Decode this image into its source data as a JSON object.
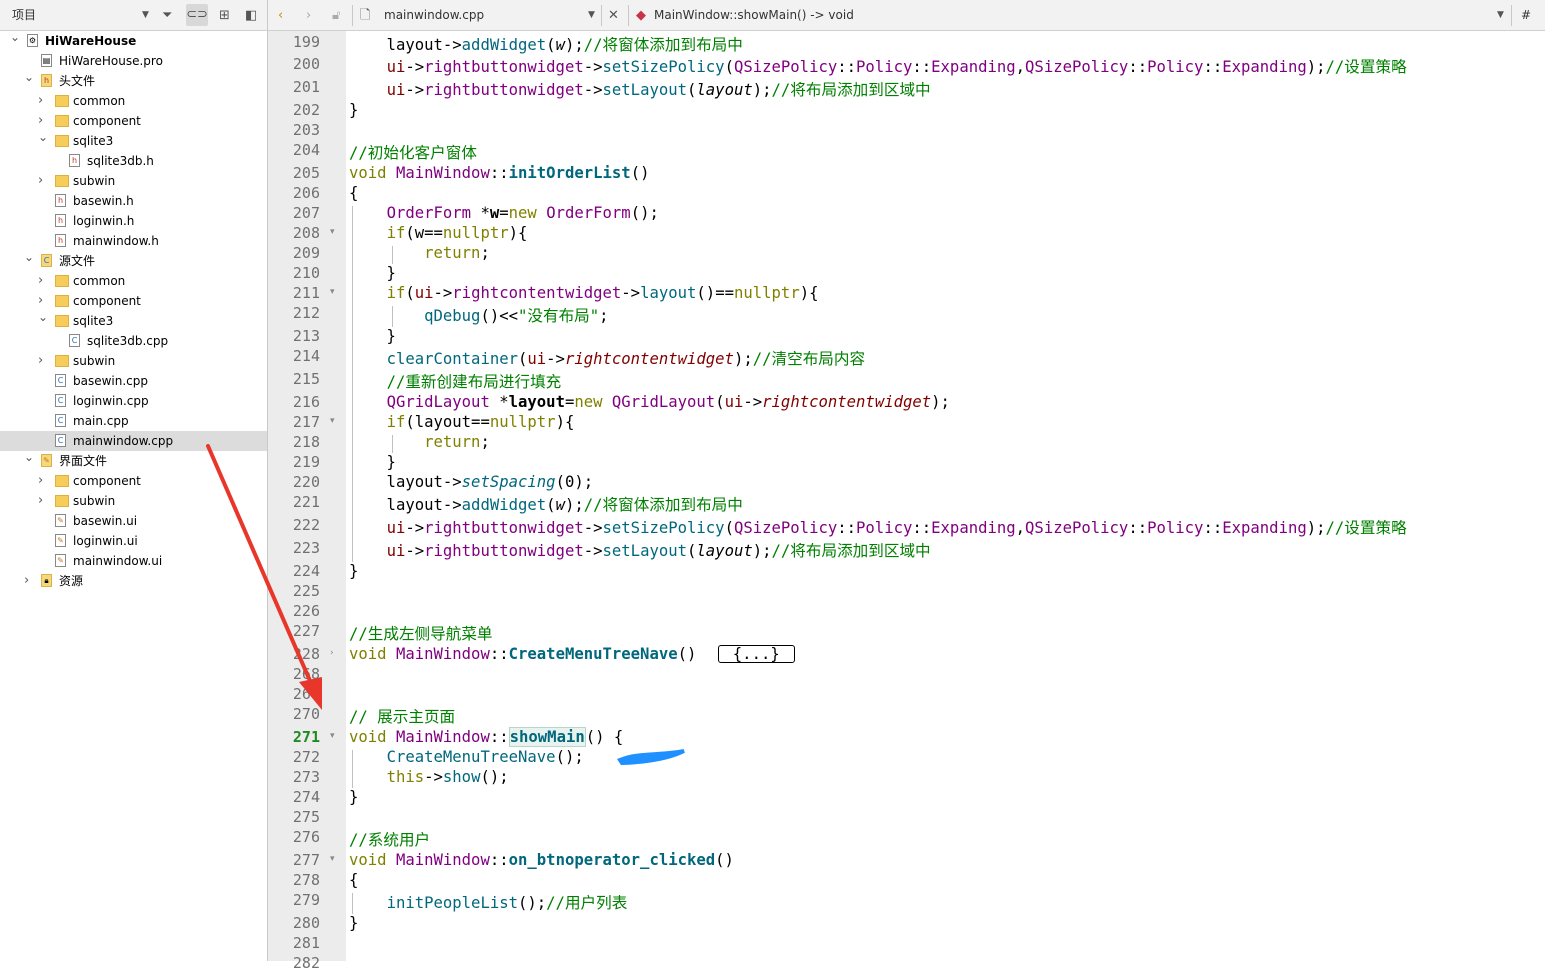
{
  "project_panel": {
    "title": "项目",
    "tree": [
      {
        "label": "HiWareHouse",
        "level": 0,
        "type": "project",
        "expanded": true,
        "bold": true
      },
      {
        "label": "HiWareHouse.pro",
        "level": 1,
        "type": "pro"
      },
      {
        "label": "头文件",
        "level": 1,
        "type": "group-h",
        "expanded": true
      },
      {
        "label": "common",
        "level": 2,
        "type": "folder",
        "expanded": false
      },
      {
        "label": "component",
        "level": 2,
        "type": "folder",
        "expanded": false
      },
      {
        "label": "sqlite3",
        "level": 2,
        "type": "folder",
        "expanded": true
      },
      {
        "label": "sqlite3db.h",
        "level": 3,
        "type": "h"
      },
      {
        "label": "subwin",
        "level": 2,
        "type": "folder",
        "expanded": false
      },
      {
        "label": "basewin.h",
        "level": 2,
        "type": "h"
      },
      {
        "label": "loginwin.h",
        "level": 2,
        "type": "h"
      },
      {
        "label": "mainwindow.h",
        "level": 2,
        "type": "h"
      },
      {
        "label": "源文件",
        "level": 1,
        "type": "group-cpp",
        "expanded": true
      },
      {
        "label": "common",
        "level": 2,
        "type": "folder",
        "expanded": false
      },
      {
        "label": "component",
        "level": 2,
        "type": "folder",
        "expanded": false
      },
      {
        "label": "sqlite3",
        "level": 2,
        "type": "folder",
        "expanded": true
      },
      {
        "label": "sqlite3db.cpp",
        "level": 3,
        "type": "cpp"
      },
      {
        "label": "subwin",
        "level": 2,
        "type": "folder",
        "expanded": false
      },
      {
        "label": "basewin.cpp",
        "level": 2,
        "type": "cpp"
      },
      {
        "label": "loginwin.cpp",
        "level": 2,
        "type": "cpp"
      },
      {
        "label": "main.cpp",
        "level": 2,
        "type": "cpp"
      },
      {
        "label": "mainwindow.cpp",
        "level": 2,
        "type": "cpp",
        "selected": true
      },
      {
        "label": "界面文件",
        "level": 1,
        "type": "group-ui",
        "expanded": true
      },
      {
        "label": "component",
        "level": 2,
        "type": "folder",
        "expanded": false
      },
      {
        "label": "subwin",
        "level": 2,
        "type": "folder",
        "expanded": false
      },
      {
        "label": "basewin.ui",
        "level": 2,
        "type": "ui"
      },
      {
        "label": "loginwin.ui",
        "level": 2,
        "type": "ui"
      },
      {
        "label": "mainwindow.ui",
        "level": 2,
        "type": "ui"
      },
      {
        "label": "资源",
        "level": 1,
        "type": "group-res",
        "expanded": false
      }
    ]
  },
  "editor_toolbar": {
    "file": "mainwindow.cpp",
    "function": "MainWindow::showMain() -> void",
    "hash": "#"
  },
  "editor": {
    "current_line": 271,
    "lines": [
      {
        "n": "199",
        "html": "    layout-><span class='f'>addWidget</span>(<span class='it'>w</span>);<span class='c'>//将窗体添加到布局中</span>"
      },
      {
        "n": "200",
        "html": "    <span class='m' style='font-style:normal'>ui</span>-><span class='t'>rightbuttonwidget</span>-><span class='f'>setSizePolicy</span>(<span class='t'>QSizePolicy</span>::<span class='t'>Policy</span>::<span class='t'>Expanding</span>,<span class='t'>QSizePolicy</span>::<span class='t'>Policy</span>::<span class='t'>Expanding</span>);<span class='c'>//设置策略</span>"
      },
      {
        "n": "201",
        "html": "    <span class='m' style='font-style:normal'>ui</span>-><span class='t'>rightbuttonwidget</span>-><span class='f'>setLayout</span>(<span class='it'>layout</span>);<span class='c'>//将布局添加到区域中</span>"
      },
      {
        "n": "202",
        "html": "}"
      },
      {
        "n": "203",
        "html": ""
      },
      {
        "n": "204",
        "html": "<span class='c'>//初始化客户窗体</span>"
      },
      {
        "n": "205",
        "html": "<span class='k'>void</span> <span class='t'>MainWindow</span>::<span class='fb'>initOrderList</span>()"
      },
      {
        "n": "206",
        "html": "{"
      },
      {
        "n": "207",
        "html": "    <span class='t'>OrderForm</span> *<b>w</b>=<span class='k'>new</span> <span class='t'>OrderForm</span>();"
      },
      {
        "n": "208",
        "html": "    <span class='k'>if</span>(w==<span class='k'>nullptr</span>){"
      },
      {
        "n": "209",
        "html": "        <span class='k'>return</span>;"
      },
      {
        "n": "210",
        "html": "    }"
      },
      {
        "n": "211",
        "html": "    <span class='k'>if</span>(<span class='m' style='font-style:normal'>ui</span>-><span class='t'>rightcontentwidget</span>-><span class='f'>layout</span>()==<span class='k'>nullptr</span>){"
      },
      {
        "n": "212",
        "html": "        <span class='f'>qDebug</span>()<<<span class='s'>\"没有布局\"</span>;"
      },
      {
        "n": "213",
        "html": "    }"
      },
      {
        "n": "214",
        "html": "    <span class='f'>clearContainer</span>(<span class='m' style='font-style:normal'>ui</span>-><span class='m'>rightcontentwidget</span>);<span class='c'>//清空布局内容</span>"
      },
      {
        "n": "215",
        "html": "    <span class='c'>//重新创建布局进行填充</span>"
      },
      {
        "n": "216",
        "html": "    <span class='t'>QGridLayout</span> *<b>layout</b>=<span class='k'>new</span> <span class='t'>QGridLayout</span>(<span class='m' style='font-style:normal'>ui</span>-><span class='m'>rightcontentwidget</span>);"
      },
      {
        "n": "217",
        "html": "    <span class='k'>if</span>(layout==<span class='k'>nullptr</span>){"
      },
      {
        "n": "218",
        "html": "        <span class='k'>return</span>;"
      },
      {
        "n": "219",
        "html": "    }"
      },
      {
        "n": "220",
        "html": "    layout-><span class='f it'>setSpacing</span>(0);"
      },
      {
        "n": "221",
        "html": "    layout-><span class='f'>addWidget</span>(<span class='it'>w</span>);<span class='c'>//将窗体添加到布局中</span>"
      },
      {
        "n": "222",
        "html": "    <span class='m' style='font-style:normal'>ui</span>-><span class='t'>rightbuttonwidget</span>-><span class='f'>setSizePolicy</span>(<span class='t'>QSizePolicy</span>::<span class='t'>Policy</span>::<span class='t'>Expanding</span>,<span class='t'>QSizePolicy</span>::<span class='t'>Policy</span>::<span class='t'>Expanding</span>);<span class='c'>//设置策略</span>"
      },
      {
        "n": "223",
        "html": "    <span class='m' style='font-style:normal'>ui</span>-><span class='t'>rightbuttonwidget</span>-><span class='f'>setLayout</span>(<span class='it'>layout</span>);<span class='c'>//将布局添加到区域中</span>"
      },
      {
        "n": "224",
        "html": "}"
      },
      {
        "n": "225",
        "html": ""
      },
      {
        "n": "226",
        "html": ""
      },
      {
        "n": "227",
        "html": "<span class='c'>//生成左侧导航菜单</span>"
      },
      {
        "n": "228",
        "html": "<span class='k'>void</span> <span class='t'>MainWindow</span>::<span class='fb'>CreateMenuTreeNave</span>() <span class='collapsed'>{...}</span>"
      },
      {
        "n": "268",
        "html": ""
      },
      {
        "n": "269",
        "html": ""
      },
      {
        "n": "270",
        "html": "<span class='c'>// 展示主页面</span>"
      },
      {
        "n": "271",
        "html": "<span class='k'>void</span> <span class='t'>MainWindow</span>::<span class='fb hl-word'>showMain</span>() {"
      },
      {
        "n": "272",
        "html": "    <span class='f'>CreateMenuTreeNave</span>();"
      },
      {
        "n": "273",
        "html": "    <span class='k'>this</span>-><span class='f'>show</span>();"
      },
      {
        "n": "274",
        "html": "}"
      },
      {
        "n": "275",
        "html": ""
      },
      {
        "n": "276",
        "html": "<span class='c'>//系统用户</span>"
      },
      {
        "n": "277",
        "html": "<span class='k'>void</span> <span class='t'>MainWindow</span>::<span class='fb'>on_btnoperator_clicked</span>()"
      },
      {
        "n": "278",
        "html": "{"
      },
      {
        "n": "279",
        "html": "    <span class='f'>initPeopleList</span>();<span class='c'>//用户列表</span>"
      },
      {
        "n": "280",
        "html": "}"
      },
      {
        "n": "281",
        "html": ""
      },
      {
        "n": "282",
        "html": ""
      }
    ]
  },
  "colors": {
    "arrow": "#e8362b",
    "scribble": "#1e90ff",
    "current_line_number": "#1f8a1f"
  }
}
